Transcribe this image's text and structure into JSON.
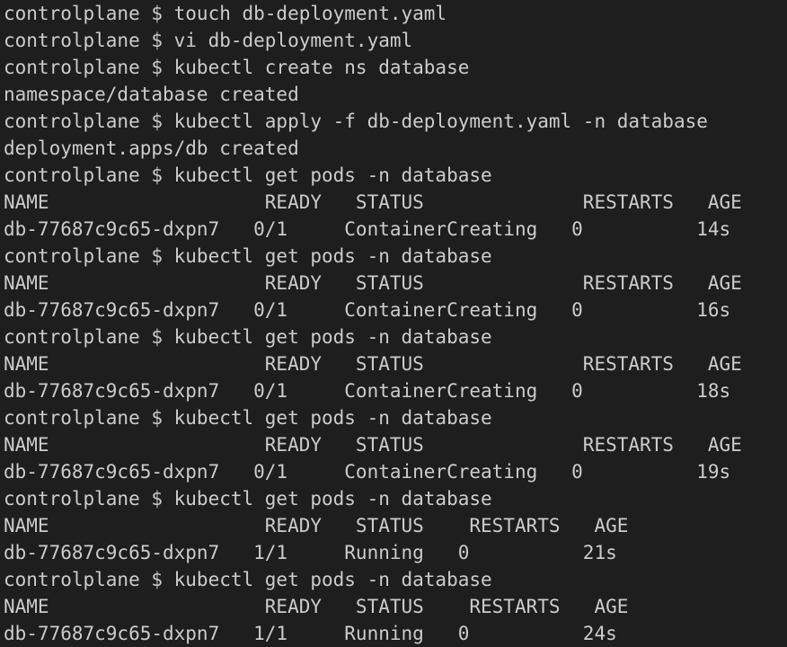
{
  "terminal": {
    "text_color": "#cccccc",
    "background_color": "#1e1e1e",
    "lines": [
      "controlplane $ touch db-deployment.yaml",
      "controlplane $ vi db-deployment.yaml",
      "controlplane $ kubectl create ns database",
      "namespace/database created",
      "controlplane $ kubectl apply -f db-deployment.yaml -n database",
      "deployment.apps/db created",
      "controlplane $ kubectl get pods -n database",
      "NAME                   READY   STATUS              RESTARTS   AGE",
      "db-77687c9c65-dxpn7   0/1     ContainerCreating   0          14s",
      "controlplane $ kubectl get pods -n database",
      "NAME                   READY   STATUS              RESTARTS   AGE",
      "db-77687c9c65-dxpn7   0/1     ContainerCreating   0          16s",
      "controlplane $ kubectl get pods -n database",
      "NAME                   READY   STATUS              RESTARTS   AGE",
      "db-77687c9c65-dxpn7   0/1     ContainerCreating   0          18s",
      "controlplane $ kubectl get pods -n database",
      "NAME                   READY   STATUS              RESTARTS   AGE",
      "db-77687c9c65-dxpn7   0/1     ContainerCreating   0          19s",
      "controlplane $ kubectl get pods -n database",
      "NAME                   READY   STATUS    RESTARTS   AGE",
      "db-77687c9c65-dxpn7   1/1     Running   0          21s",
      "controlplane $ kubectl get pods -n database",
      "NAME                   READY   STATUS    RESTARTS   AGE",
      "db-77687c9c65-dxpn7   1/1     Running   0          24s"
    ]
  }
}
